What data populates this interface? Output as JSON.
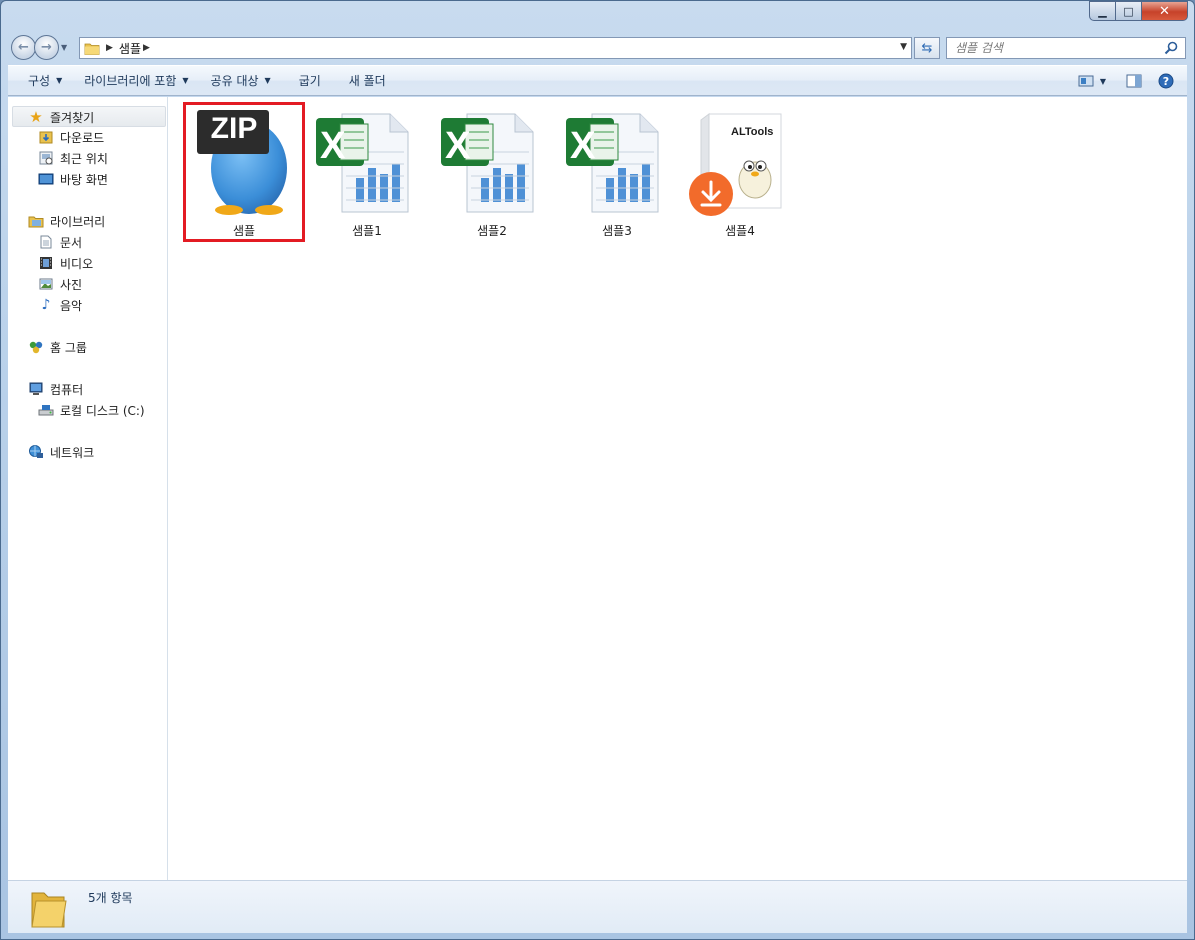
{
  "window": {
    "controls": {
      "minimize": "▁",
      "maximize": "□",
      "close": "✕"
    }
  },
  "address_bar": {
    "crumb": "샘플",
    "search_placeholder": "샘플 검색"
  },
  "toolbar": {
    "items": [
      {
        "label": "구성",
        "dropdown": true
      },
      {
        "label": "라이브러리에 포함",
        "dropdown": true
      },
      {
        "label": "공유 대상",
        "dropdown": true
      },
      {
        "label": "굽기",
        "dropdown": false
      },
      {
        "label": "새 폴더",
        "dropdown": false
      }
    ],
    "help_glyph": "?"
  },
  "nav": {
    "favorites": {
      "label": "즐겨찾기",
      "items": [
        "다운로드",
        "최근 위치",
        "바탕 화면"
      ]
    },
    "libraries": {
      "label": "라이브러리",
      "items": [
        "문서",
        "비디오",
        "사진",
        "음악"
      ]
    },
    "homegroup": {
      "label": "홈 그룹"
    },
    "computer": {
      "label": "컴퓨터",
      "items": [
        "로컬 디스크 (C:)"
      ]
    },
    "network": {
      "label": "네트워크"
    }
  },
  "files": [
    {
      "name": "샘플",
      "type": "zip",
      "icon": "alzip-zip-icon",
      "badge": "ZIP",
      "selected": true
    },
    {
      "name": "샘플1",
      "type": "excel",
      "icon": "excel-icon",
      "selected": false
    },
    {
      "name": "샘플2",
      "type": "excel",
      "icon": "excel-icon",
      "selected": false
    },
    {
      "name": "샘플3",
      "type": "excel",
      "icon": "excel-icon",
      "selected": false
    },
    {
      "name": "샘플4",
      "type": "installer",
      "icon": "altools-installer-icon",
      "box_text": "ALTools",
      "selected": false
    }
  ],
  "status": {
    "count_text": "5개 항목"
  },
  "colors": {
    "selection_outline": "#e31b23",
    "excel_green": "#1e7b34",
    "zip_blue": "#3b8ed8",
    "download_orange": "#f26b2b"
  }
}
